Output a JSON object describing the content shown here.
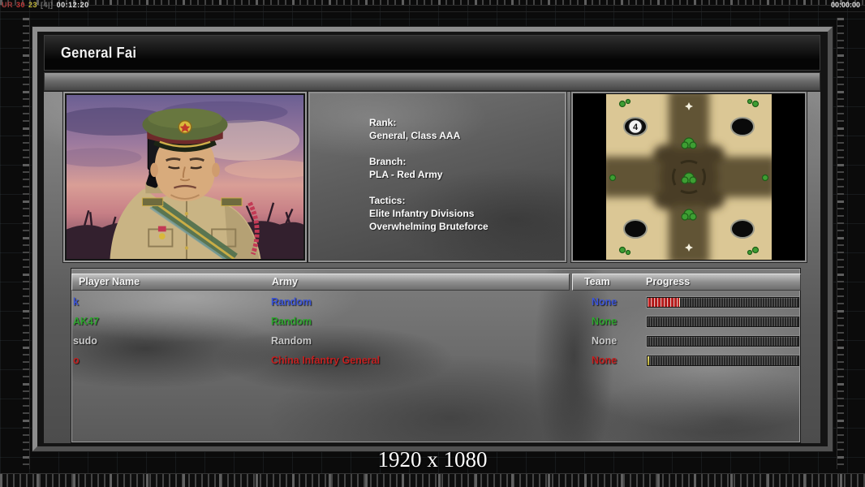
{
  "hud": {
    "debug_segments": [
      {
        "text": "UR",
        "color": "#a33c3c"
      },
      {
        "text": "30",
        "color": "#c23434"
      },
      {
        "text": "23",
        "color": "#c2b63a"
      },
      {
        "text": "[4|]",
        "color": "#6f6f6f"
      },
      {
        "text": "00:12:20",
        "color": "#e2e2e2"
      }
    ],
    "match_timer": "00:00:00",
    "resolution_label": "1920 x 1080"
  },
  "panel": {
    "title": "General Fai",
    "bio": {
      "rank_label": "Rank:",
      "rank_value": "General, Class AAA",
      "branch_label": "Branch:",
      "branch_value": "PLA - Red Army",
      "tactics_label": "Tactics:",
      "tactics_line1": "Elite Infantry Divisions",
      "tactics_line2": "Overwhelming Bruteforce"
    },
    "map_preview": {
      "start_position_badge": "4",
      "map_background_color": "#dbc795"
    },
    "lobby": {
      "headers": {
        "player": "Player Name",
        "army": "Army",
        "team": "Team",
        "progress": "Progress"
      },
      "rows": [
        {
          "player": "k",
          "army": "Random",
          "team": "None",
          "color": "#3d55d6",
          "progress_pct": 21,
          "progress_style": "red-striped"
        },
        {
          "player": "AK47",
          "army": "Random",
          "team": "None",
          "color": "#2fa52f",
          "progress_pct": 0,
          "progress_style": "none"
        },
        {
          "player": "sudo",
          "army": "Random",
          "team": "None",
          "color": "#c9c9c9",
          "progress_pct": 0,
          "progress_style": "none"
        },
        {
          "player": "o",
          "army": "China Infantry General",
          "team": "None",
          "color": "#c32020",
          "progress_pct": 1,
          "progress_style": "yellow"
        }
      ]
    }
  }
}
